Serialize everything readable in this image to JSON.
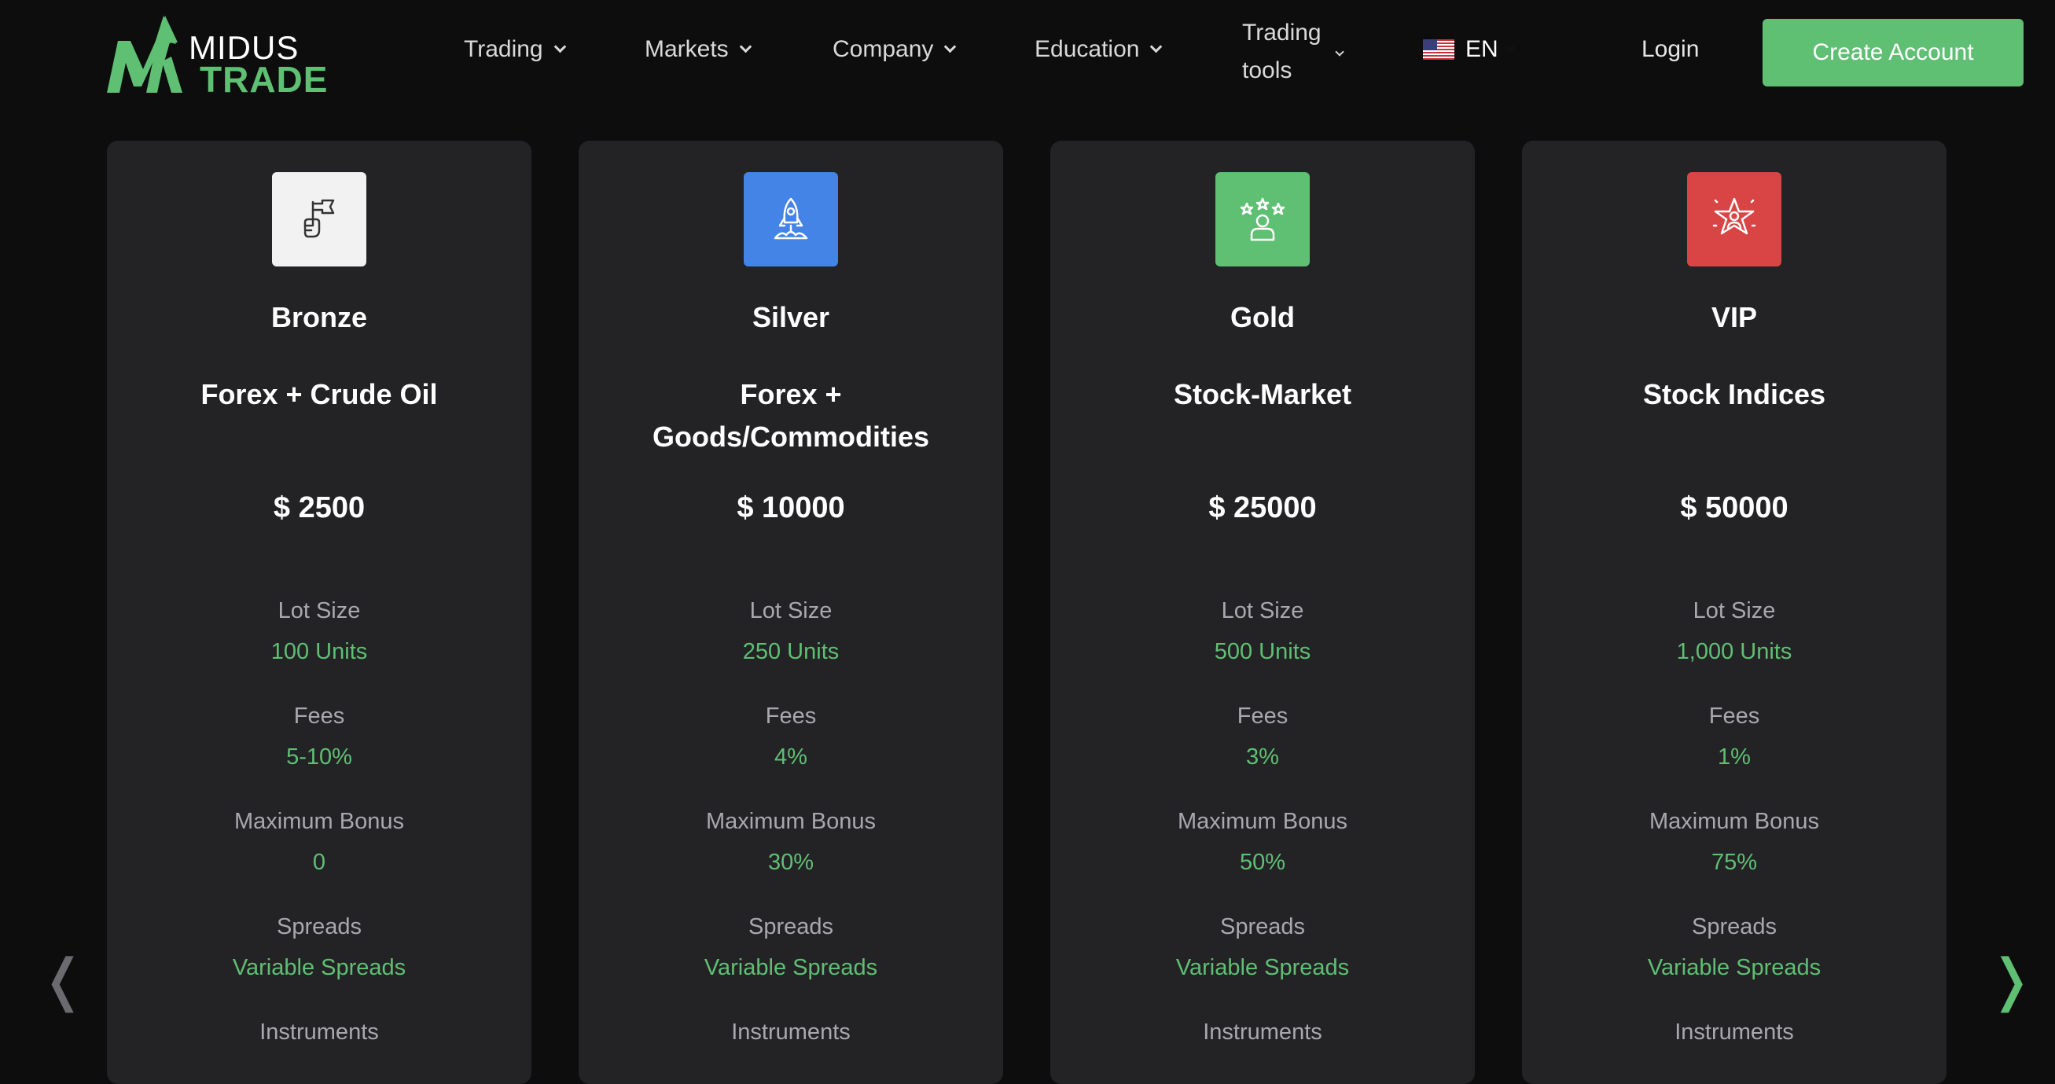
{
  "brand": {
    "name_top": "MIDUS",
    "name_bottom": "TRADE",
    "accent_color": "#5fbf73"
  },
  "nav": {
    "trading": "Trading",
    "markets": "Markets",
    "company": "Company",
    "education": "Education",
    "tools_line1": "Trading",
    "tools_line2": "tools",
    "language": "EN",
    "language_flag_icon": "us-flag-icon",
    "login": "Login",
    "create_account": "Create Account"
  },
  "labels": {
    "lot_size": "Lot Size",
    "fees": "Fees",
    "max_bonus": "Maximum Bonus",
    "spreads": "Spreads",
    "instruments": "Instruments"
  },
  "plans": [
    {
      "title": "Bronze",
      "subtitle": "Forex + Crude Oil",
      "price": "$ 2500",
      "lot_size": "100 Units",
      "fees": "5-10%",
      "max_bonus": "0",
      "spreads": "Variable Spreads",
      "icon": "flag-hand-icon",
      "icon_bg": "#f2f2f2"
    },
    {
      "title": "Silver",
      "subtitle": "Forex + Goods/Commodities",
      "price": "$ 10000",
      "lot_size": "250 Units",
      "fees": "4%",
      "max_bonus": "30%",
      "spreads": "Variable Spreads",
      "icon": "rocket-icon",
      "icon_bg": "#4384e6"
    },
    {
      "title": "Gold",
      "subtitle": "Stock-Market",
      "price": "$ 25000",
      "lot_size": "500 Units",
      "fees": "3%",
      "max_bonus": "50%",
      "spreads": "Variable Spreads",
      "icon": "person-stars-icon",
      "icon_bg": "#5fbf73"
    },
    {
      "title": "VIP",
      "subtitle": "Stock Indices",
      "price": "$ 50000",
      "lot_size": "1,000 Units",
      "fees": "1%",
      "max_bonus": "75%",
      "spreads": "Variable Spreads",
      "icon": "star-person-icon",
      "icon_bg": "#d94545"
    }
  ],
  "carousel": {
    "prev_icon": "chevron-left-icon",
    "next_icon": "chevron-right-icon",
    "prev_glyph": "❬",
    "next_glyph": "❭"
  }
}
